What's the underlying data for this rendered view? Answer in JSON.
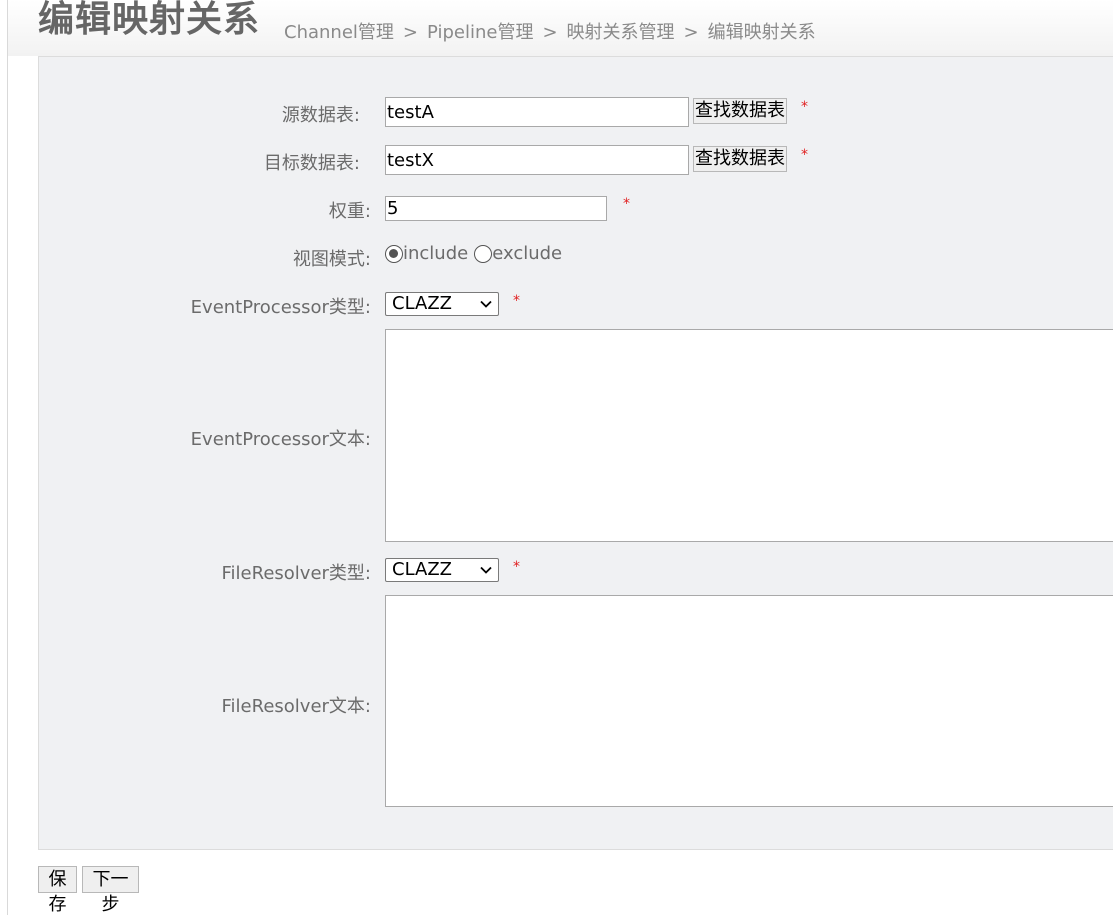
{
  "page": {
    "title": "编辑映射关系",
    "breadcrumb": [
      "Channel管理",
      "Pipeline管理",
      "映射关系管理",
      "编辑映射关系"
    ],
    "breadcrumb_separator": ">"
  },
  "form": {
    "source_table": {
      "label": "源数据表:",
      "value": "testA",
      "button": "查找数据表",
      "required_mark": "*"
    },
    "target_table": {
      "label": "目标数据表:",
      "value": "testX",
      "button": "查找数据表",
      "required_mark": "*"
    },
    "weight": {
      "label": "权重:",
      "value": "5",
      "required_mark": "*"
    },
    "view_mode": {
      "label": "视图模式:",
      "options": [
        "include",
        "exclude"
      ],
      "selected": "include"
    },
    "event_processor_type": {
      "label": "EventProcessor类型:",
      "value": "CLAZZ",
      "required_mark": "*"
    },
    "event_processor_text": {
      "label": "EventProcessor文本:",
      "value": ""
    },
    "file_resolver_type": {
      "label": "FileResolver类型:",
      "value": "CLAZZ",
      "required_mark": "*"
    },
    "file_resolver_text": {
      "label": "FileResolver文本:",
      "value": ""
    }
  },
  "actions": {
    "save": "保存",
    "next": "下一步"
  },
  "colors": {
    "required": "#e02020",
    "panel_bg": "#f0f1f3",
    "label": "#6b6b6b"
  }
}
